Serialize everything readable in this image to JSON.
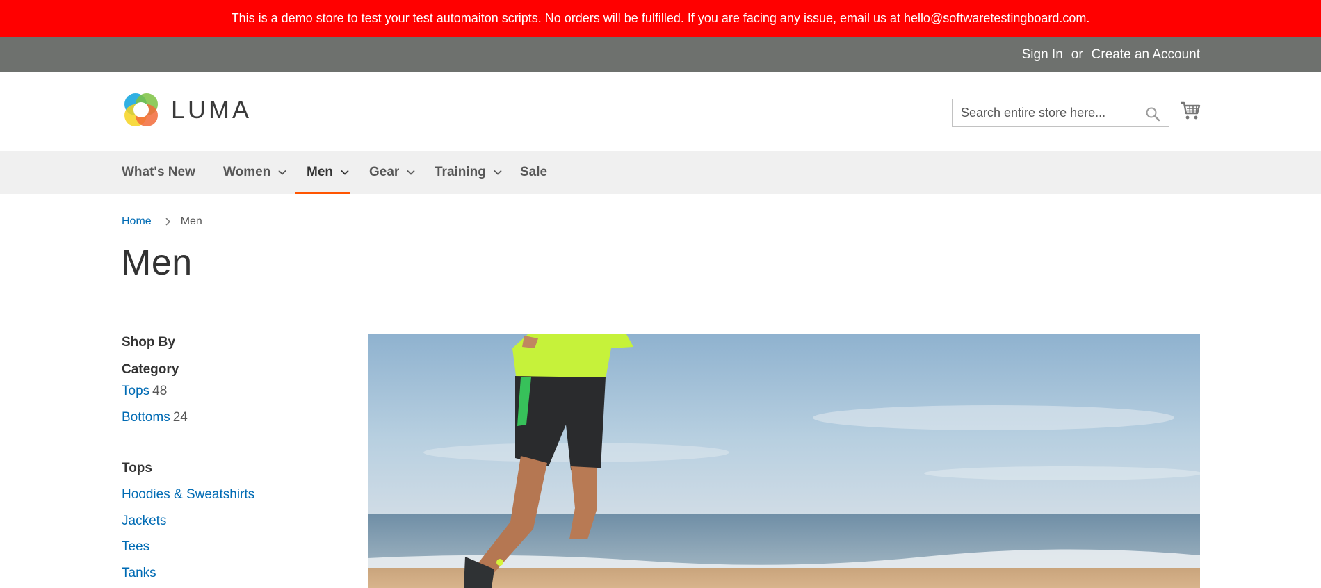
{
  "banner": {
    "text": "This is a demo store to test your test automaiton scripts. No orders will be fulfilled. If you are facing any issue, email us at hello@softwaretestingboard.com."
  },
  "header": {
    "sign_in": "Sign In",
    "or": "or",
    "create_account": "Create an Account"
  },
  "logo": {
    "text": "LUMA"
  },
  "search": {
    "placeholder": "Search entire store here..."
  },
  "icons": {
    "search": "search-icon",
    "cart": "cart-icon",
    "chevron": "chevron-down-icon",
    "breadcrumb_separator": "chevron-right-icon"
  },
  "nav": {
    "items": [
      {
        "label": "What's New",
        "has_dropdown": false,
        "active": false
      },
      {
        "label": "Women",
        "has_dropdown": true,
        "active": false
      },
      {
        "label": "Men",
        "has_dropdown": true,
        "active": true
      },
      {
        "label": "Gear",
        "has_dropdown": true,
        "active": false
      },
      {
        "label": "Training",
        "has_dropdown": true,
        "active": false
      },
      {
        "label": "Sale",
        "has_dropdown": false,
        "active": false
      }
    ]
  },
  "breadcrumb": {
    "home": "Home",
    "current": "Men"
  },
  "page": {
    "title": "Men"
  },
  "sidebar": {
    "shop_by": "Shop By",
    "category_title": "Category",
    "categories": [
      {
        "label": "Tops",
        "count": "48"
      },
      {
        "label": "Bottoms",
        "count": "24"
      }
    ],
    "tops_title": "Tops",
    "tops_links": [
      "Hoodies & Sweatshirts",
      "Jackets",
      "Tees",
      "Tanks"
    ]
  },
  "colors": {
    "banner_bg": "#ff0000",
    "header_bg": "#6e716e",
    "nav_bg": "#f0f0f0",
    "link": "#006bb4",
    "accent": "#ff5501"
  }
}
